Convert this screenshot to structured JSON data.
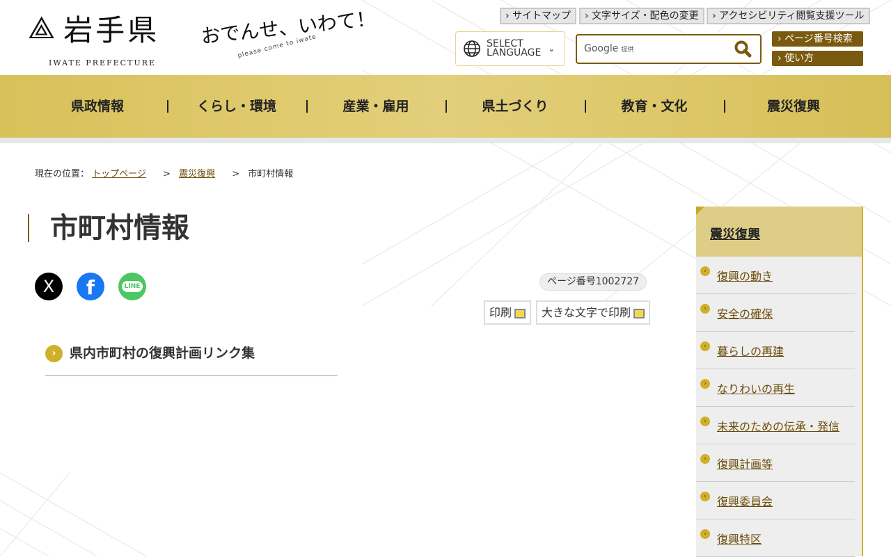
{
  "header": {
    "logo_text": "岩手県",
    "logo_en": "IWATE PREFECTURE",
    "slogan": "おでんせ、いわて！",
    "slogan_sub": "please come to iwate",
    "utility_links": [
      "サイトマップ",
      "文字サイズ・配色の変更",
      "アクセシビリティ閲覧支援ツール"
    ],
    "language_line1": "SELECT",
    "language_line2": "LANGUAGE",
    "search_placeholder": "Google",
    "search_provider": "提供",
    "page_number_search": "ページ番号検索",
    "how_to_use": "使い方"
  },
  "nav": [
    "県政情報",
    "くらし・環境",
    "産業・雇用",
    "県土づくり",
    "教育・文化",
    "震災復興"
  ],
  "breadcrumb": {
    "label": "現在の位置：",
    "items": [
      "トップページ",
      "震災復興"
    ],
    "current": "市町村情報"
  },
  "page": {
    "title": "市町村情報",
    "page_number": "ページ番号1002727",
    "print": "印刷",
    "print_large": "大きな文字で印刷",
    "sns": {
      "x": "X",
      "facebook": "f",
      "line": "LINE"
    },
    "links": [
      "県内市町村の復興計画リンク集"
    ]
  },
  "sidebar": {
    "title": "震災復興",
    "items": [
      "復興の動き",
      "安全の確保",
      "暮らしの再建",
      "なりわいの再生",
      "未来のための伝承・発信",
      "復興計画等",
      "復興委員会",
      "復興特区"
    ]
  },
  "colors": {
    "accent": "#7a5a0f",
    "gold": "#d8c15a"
  }
}
